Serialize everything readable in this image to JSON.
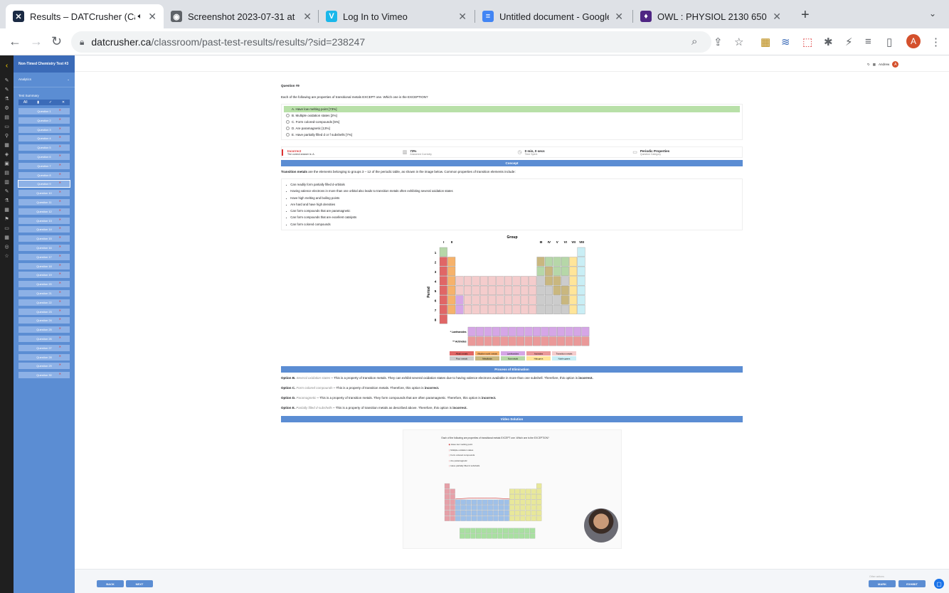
{
  "tabs": [
    {
      "title": "Results – DATCrusher (Can",
      "icon": "x-logo-icon",
      "color": "#1b2a44",
      "fav": "✕",
      "active": true,
      "audio": true
    },
    {
      "title": "Screenshot 2023-07-31 at 5.0",
      "icon": "globe-icon",
      "color": "#5f6368",
      "fav": "◉"
    },
    {
      "title": "Log In to Vimeo",
      "icon": "vimeo-icon",
      "color": "#1ab7ea",
      "fav": "V"
    },
    {
      "title": "Untitled document - Google Do",
      "icon": "docs-icon",
      "color": "#4285f4",
      "fav": "≡"
    },
    {
      "title": "OWL : PHYSIOL 2130 650 SU2",
      "icon": "shield-icon",
      "color": "#4f2683",
      "fav": "♦"
    }
  ],
  "address": {
    "domain": "datcrusher.ca",
    "path": "/classroom/past-test-results/results/?sid=238247",
    "avatar": "A"
  },
  "sidebar": {
    "title": "Non-Timed Chemistry Test #3",
    "analytics": "Analytics",
    "summary": "Test Summary",
    "tools": [
      "All",
      "▮",
      "✓",
      "✕"
    ],
    "questions": [
      "Question 1",
      "Question 2",
      "Question 3",
      "Question 4",
      "Question 5",
      "Question 6",
      "Question 7",
      "Question 8",
      "Question 9",
      "Question 10",
      "Question 11",
      "Question 12",
      "Question 13",
      "Question 14",
      "Question 15",
      "Question 16",
      "Question 17",
      "Question 18",
      "Question 19",
      "Question 20",
      "Question 21",
      "Question 22",
      "Question 23",
      "Question 24",
      "Question 25",
      "Question 26",
      "Question 27",
      "Question 28",
      "Question 29",
      "Question 30"
    ],
    "selected_index": 8
  },
  "header": {
    "user": "Andrew",
    "user_initial": "A"
  },
  "question": {
    "number": "Question #9",
    "text": "Each of the following are properties of transitional metals EXCEPT one. Which one is the EXCEPTION?",
    "options": [
      {
        "label": "A. Have low melting point [73%]",
        "correct": true
      },
      {
        "label": "B. Multiple oxidation states [2%]"
      },
      {
        "label": "C. Form colored-compounds [5%]"
      },
      {
        "label": "D. Are paramagnetic [13%]"
      },
      {
        "label": "E. Have partially filled d or f subshells [7%]"
      }
    ]
  },
  "stats": {
    "result": "Incorrect",
    "result_sub": "The correct answer is: A.",
    "pct": "73%",
    "pct_sub": "Answered Correctly",
    "time": "0 min, 0 secs",
    "time_sub": "Time Spent",
    "cat": "Periodic Properties",
    "cat_sub": "Question Category"
  },
  "concept": {
    "header": "Concept",
    "intro_bold": "Transition metals",
    "intro": " are the elements belonging to groups 3 – 12 of the periodic table, as shown in the image below. Common properties of transition elements include:",
    "bullets": [
      "Can readily form partially filled d-orbitals",
      "Having valence electrons in more than one orbital also leads to transition metals often exhibiting several oxidation states",
      "Have high melting and boiling points",
      "Are hard and have high densities",
      "Can form compounds that are paramagnetic",
      "Can form compounds that are excellent catalysts",
      "Can form colored compounds"
    ]
  },
  "ptable": {
    "group_label": "Group",
    "period_label": "Period",
    "groups_left": [
      "I",
      "II"
    ],
    "groups_right": [
      "III",
      "IV",
      "V",
      "VI",
      "VII",
      "VIII"
    ],
    "periods": [
      "1",
      "2",
      "3",
      "4",
      "5",
      "6",
      "7",
      "8"
    ],
    "lanth_label": "* Lanthanides",
    "actin_label": "** Actinides",
    "legend": [
      {
        "label": "Alkali metals",
        "color": "#e06666"
      },
      {
        "label": "Alkaline earth metals",
        "color": "#f6b26b"
      },
      {
        "label": "Lanthanides",
        "color": "#d5a6e6"
      },
      {
        "label": "Actinides",
        "color": "#ea9999"
      },
      {
        "label": "Transition metals",
        "color": "#f4cccc"
      },
      {
        "label": "Poor metals",
        "color": "#cccccc"
      },
      {
        "label": "Metalloids",
        "color": "#c9b77f"
      },
      {
        "label": "Nonmetals",
        "color": "#b6d7a8"
      },
      {
        "label": "Halogens",
        "color": "#ffe599"
      },
      {
        "label": "Noble gases",
        "color": "#c9eef5"
      }
    ],
    "source": "Source: https://commons.wikimedia.org/wiki/File:Periodic_Table_Armtuk3.svg",
    "colors": {
      "alkali": "#e06666",
      "alkaline": "#f6b26b",
      "transition": "#f4cccc",
      "poor": "#cccccc",
      "metalloid": "#c9b77f",
      "nonmetal": "#b6d7a8",
      "halogen": "#ffe599",
      "noble": "#c9eef5",
      "lanth": "#d5a6e6",
      "actin": "#ea9999",
      "h": "#b6d7a8"
    }
  },
  "elimination": {
    "header": "Process of Elimination",
    "options": [
      {
        "b": "Option B.",
        "i": "Several oxidation states",
        "t": " – This is a property of transition metals. They can exhibit several oxidation states due to having valence electrons available in more than one subshell. Therefore, this option is ",
        "end": "incorrect."
      },
      {
        "b": "Option C.",
        "i": "Form colored compounds",
        "t": " – This is a property of transition metals. Therefore, this option is ",
        "end": "incorrect."
      },
      {
        "b": "Option D.",
        "i": "Paramagnetic",
        "t": " – This is a property of transition metals. They form compounds that are often paramagnetic. Therefore, this option is ",
        "end": "incorrect."
      },
      {
        "b": "Option E.",
        "i": "Partially filled d-subshells",
        "t": " – This is a property of transition metals as described above. Therefore, this option is ",
        "end": "incorrect."
      }
    ]
  },
  "video": {
    "header": "Video Solution",
    "question": "Each of the following are properties of transitional metals EXCEPT one. Which one is the EXCEPTION?",
    "options": [
      "Have low melting point",
      "Multiple oxidation states",
      "Form colored compounds",
      "Are paramagnetic",
      "Have partially filled d subshells"
    ]
  },
  "footer": {
    "back": "BACK",
    "next": "NEXT",
    "mark": "MARK",
    "exhibit": "EXHIBIT",
    "other": "Other actions"
  }
}
